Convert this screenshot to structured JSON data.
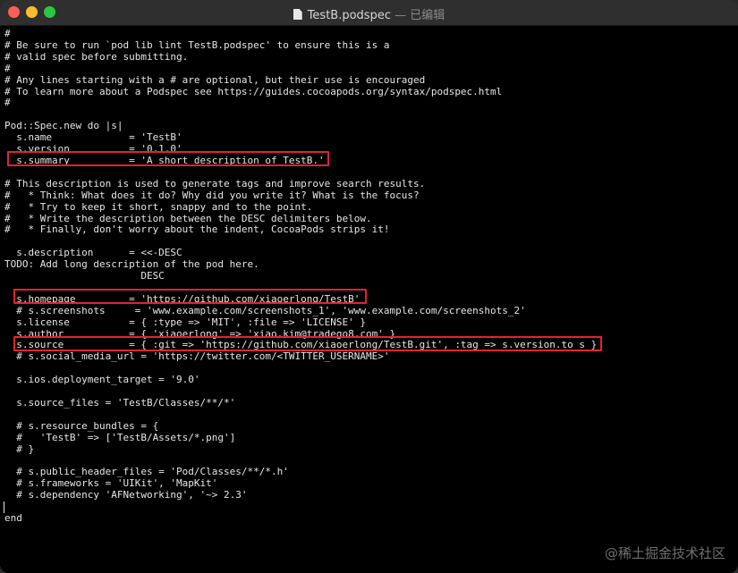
{
  "window": {
    "filename": "TestB.podspec",
    "separator": "—",
    "status": "已编辑"
  },
  "editor": {
    "lines": [
      "#",
      "# Be sure to run `pod lib lint TestB.podspec' to ensure this is a",
      "# valid spec before submitting.",
      "#",
      "# Any lines starting with a # are optional, but their use is encouraged",
      "# To learn more about a Podspec see https://guides.cocoapods.org/syntax/podspec.html",
      "#",
      "",
      "Pod::Spec.new do |s|",
      "  s.name             = 'TestB'",
      "  s.version          = '0.1.0'",
      "  s.summary          = 'A short description of TestB.'",
      "",
      "# This description is used to generate tags and improve search results.",
      "#   * Think: What does it do? Why did you write it? What is the focus?",
      "#   * Try to keep it short, snappy and to the point.",
      "#   * Write the description between the DESC delimiters below.",
      "#   * Finally, don't worry about the indent, CocoaPods strips it!",
      "",
      "  s.description      = <<-DESC",
      "TODO: Add long description of the pod here.",
      "                       DESC",
      "",
      "  s.homepage         = 'https://github.com/xiaoerlong/TestB'",
      "  # s.screenshots     = 'www.example.com/screenshots_1', 'www.example.com/screenshots_2'",
      "  s.license          = { :type => 'MIT', :file => 'LICENSE' }",
      "  s.author           = { 'xiaoerlong' => 'xiao.kim@tradego8.com' }",
      "  s.source           = { :git => 'https://github.com/xiaoerlong/TestB.git', :tag => s.version.to_s }",
      "  # s.social_media_url = 'https://twitter.com/<TWITTER_USERNAME>'",
      "",
      "  s.ios.deployment_target = '9.0'",
      "",
      "  s.source_files = 'TestB/Classes/**/*'",
      "",
      "  # s.resource_bundles = {",
      "  #   'TestB' => ['TestB/Assets/*.png']",
      "  # }",
      "",
      "  # s.public_header_files = 'Pod/Classes/**/*.h'",
      "  # s.frameworks = 'UIKit', 'MapKit'",
      "  # s.dependency 'AFNetworking', '~> 2.3'",
      "",
      "end"
    ]
  },
  "watermark": "@稀土掘金技术社区",
  "colors": {
    "highlight": "#e0242f",
    "text": "#e6e6e6",
    "background": "#000000"
  }
}
